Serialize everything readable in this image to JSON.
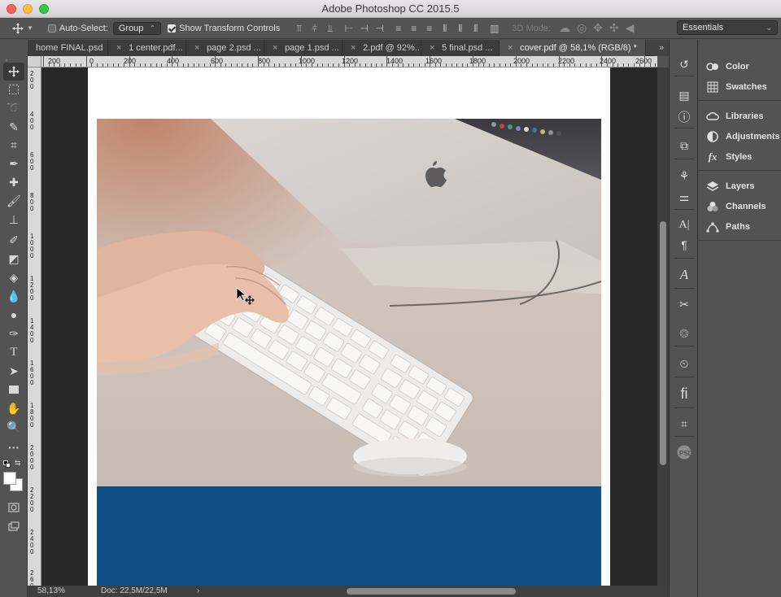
{
  "window": {
    "title": "Adobe Photoshop CC 2015.5"
  },
  "options_bar": {
    "auto_select_label": "Auto-Select:",
    "auto_select_checked": false,
    "auto_select_target": "Group",
    "show_transform_label": "Show Transform Controls",
    "show_transform_checked": true,
    "mode3d_label": "3D Mode:",
    "workspace": "Essentials"
  },
  "tabs": [
    {
      "label": "home FINAL.psd",
      "close": ""
    },
    {
      "label": "1 center.pdf...",
      "close": "×"
    },
    {
      "label": "page 2.psd ...",
      "close": "×"
    },
    {
      "label": "page 1.psd ...",
      "close": "×"
    },
    {
      "label": "2.pdf @ 92%...",
      "close": "×"
    },
    {
      "label": "5 final.psd ...",
      "close": "×"
    },
    {
      "label": "cover.pdf @ 58,1% (RGB/8) *",
      "close": "×"
    }
  ],
  "tab_overflow": "»",
  "ruler_top": [
    "200",
    "0",
    "200",
    "400",
    "600",
    "800",
    "1000",
    "1200",
    "1400",
    "1600",
    "1800",
    "2000",
    "2200",
    "2400",
    "2600"
  ],
  "ruler_left": [
    "2 0 0",
    "4 0 0",
    "6 0 0",
    "8 0 0",
    "1 0 0 0",
    "1 2 0 0",
    "1 4 0 0",
    "1 6 0 0",
    "1 8 0 0",
    "2 0 0 0",
    "2 2 0 0",
    "2 4 0 0",
    "2 6 0 0"
  ],
  "status": {
    "zoom": "58,13%",
    "doc": "Doc: 22,5M/22,5M",
    "arrow": "›"
  },
  "panels": {
    "group1": [
      {
        "label": "Color",
        "icon": "color-icon"
      },
      {
        "label": "Swatches",
        "icon": "swatches-icon"
      }
    ],
    "group2": [
      {
        "label": "Libraries",
        "icon": "libraries-icon"
      },
      {
        "label": "Adjustments",
        "icon": "adjustments-icon"
      },
      {
        "label": "Styles",
        "icon": "styles-icon"
      }
    ],
    "group3": [
      {
        "label": "Layers",
        "icon": "layers-icon"
      },
      {
        "label": "Channels",
        "icon": "channels-icon"
      },
      {
        "label": "Paths",
        "icon": "paths-icon"
      }
    ]
  },
  "colors": {
    "document_blue": "#124f86",
    "ui_dark": "#535353",
    "canvas_bg": "#282828"
  }
}
